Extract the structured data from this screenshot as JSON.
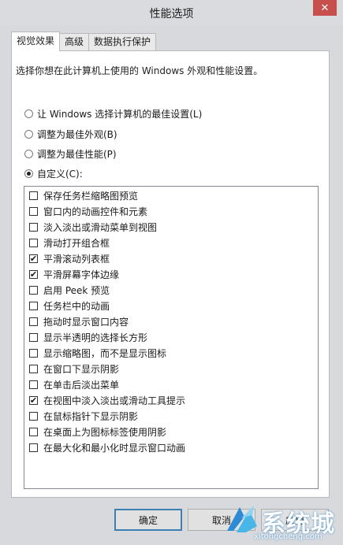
{
  "window": {
    "title": "性能选项",
    "close_glyph": "✕"
  },
  "tabs": [
    {
      "label": "视觉效果",
      "active": true
    },
    {
      "label": "高级",
      "active": false
    },
    {
      "label": "数据执行保护",
      "active": false
    }
  ],
  "description": "选择你想在此计算机上使用的 Windows 外观和性能设置。",
  "radios": [
    {
      "label": "让 Windows 选择计算机的最佳设置(L)",
      "selected": false
    },
    {
      "label": "调整为最佳外观(B)",
      "selected": false
    },
    {
      "label": "调整为最佳性能(P)",
      "selected": false
    },
    {
      "label": "自定义(C):",
      "selected": true
    }
  ],
  "options": [
    {
      "label": "保存任务栏缩略图预览",
      "checked": false
    },
    {
      "label": "窗口内的动画控件和元素",
      "checked": false
    },
    {
      "label": "淡入淡出或滑动菜单到视图",
      "checked": false
    },
    {
      "label": "滑动打开组合框",
      "checked": false
    },
    {
      "label": "平滑滚动列表框",
      "checked": true
    },
    {
      "label": "平滑屏幕字体边缘",
      "checked": true
    },
    {
      "label": "启用 Peek 预览",
      "checked": false
    },
    {
      "label": "任务栏中的动画",
      "checked": false
    },
    {
      "label": "拖动时显示窗口内容",
      "checked": false
    },
    {
      "label": "显示半透明的选择长方形",
      "checked": false
    },
    {
      "label": "显示缩略图，而不是显示图标",
      "checked": false
    },
    {
      "label": "在窗口下显示阴影",
      "checked": false
    },
    {
      "label": "在单击后淡出菜单",
      "checked": false
    },
    {
      "label": "在视图中淡入淡出或滑动工具提示",
      "checked": true
    },
    {
      "label": "在鼠标指针下显示阴影",
      "checked": false
    },
    {
      "label": "在桌面上为图标标签使用阴影",
      "checked": false
    },
    {
      "label": "在最大化和最小化时显示窗口动画",
      "checked": false
    }
  ],
  "buttons": {
    "ok": "确定",
    "cancel": "取消",
    "apply": "应用"
  },
  "watermark": {
    "text": "系统城",
    "url": "xitongcheng.com"
  },
  "check_glyph": "✔"
}
